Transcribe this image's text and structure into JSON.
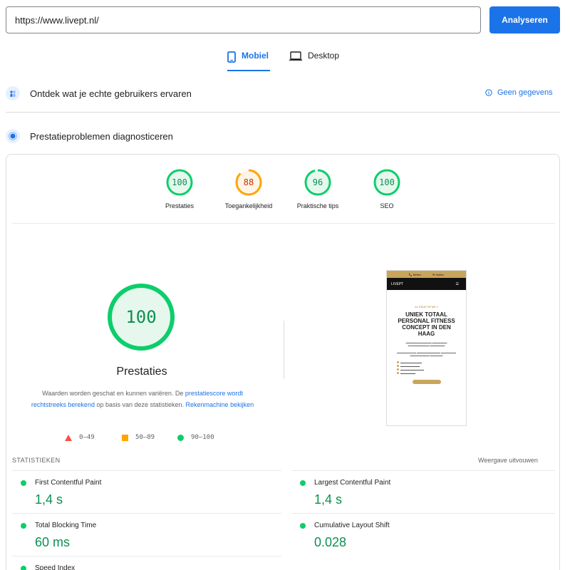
{
  "search": {
    "url_value": "https://www.livept.nl/",
    "analyze_label": "Analyseren"
  },
  "tabs": [
    {
      "label": "Mobiel",
      "icon": "phone-icon",
      "active": true
    },
    {
      "label": "Desktop",
      "icon": "desktop-icon",
      "active": false
    }
  ],
  "sections": {
    "field_data": {
      "title": "Ontdek wat je echte gebruikers ervaren",
      "no_data_label": "Geen gegevens"
    },
    "lab_data": {
      "title": "Prestatieproblemen diagnosticeren"
    }
  },
  "scores": [
    {
      "value": "100",
      "label": "Prestaties",
      "status": "pass",
      "fraction": 1.0
    },
    {
      "value": "88",
      "label": "Toegankelijkheid",
      "status": "average",
      "fraction": 0.88
    },
    {
      "value": "96",
      "label": "Praktische tips",
      "status": "pass",
      "fraction": 0.96
    },
    {
      "value": "100",
      "label": "SEO",
      "status": "pass",
      "fraction": 1.0
    }
  ],
  "performance": {
    "score": "100",
    "fraction": 1.0,
    "title": "Prestaties",
    "desc_prefix": "Waarden worden geschat en kunnen variëren. De ",
    "desc_link1": "prestatiescore wordt rechtstreeks berekend",
    "desc_middle": " op basis van deze statistieken. ",
    "desc_link2": "Rekenmachine bekijken"
  },
  "legend": [
    {
      "range": "0–49",
      "shape": "triangle",
      "color": "#ff4e42"
    },
    {
      "range": "50–89",
      "shape": "square",
      "color": "#ffa400"
    },
    {
      "range": "90–100",
      "shape": "circle",
      "color": "#0cce6b"
    }
  ],
  "thumbnail": {
    "top_bar_left": "📞 Bellen",
    "top_bar_right": "✉ Mailen",
    "logo": "LIVEPT",
    "kicker": "AL STAAT OP NR. 1",
    "headline": "UNIEK TOTAAL PERSONAL FITNESS CONCEPT IN DEN HAAG"
  },
  "stats": {
    "title": "STATISTIEKEN",
    "expand_label": "Weergave uitvouwen",
    "metrics": [
      {
        "name": "First Contentful Paint",
        "value": "1,4 s"
      },
      {
        "name": "Largest Contentful Paint",
        "value": "1,4 s"
      },
      {
        "name": "Total Blocking Time",
        "value": "60 ms"
      },
      {
        "name": "Cumulative Layout Shift",
        "value": "0.028"
      },
      {
        "name": "Speed Index",
        "value": ""
      }
    ]
  },
  "colors": {
    "accent": "#1a73e8",
    "pass": "#0cce6b",
    "pass_text": "#0d904f",
    "average": "#ffa400",
    "average_text": "#c33300"
  }
}
